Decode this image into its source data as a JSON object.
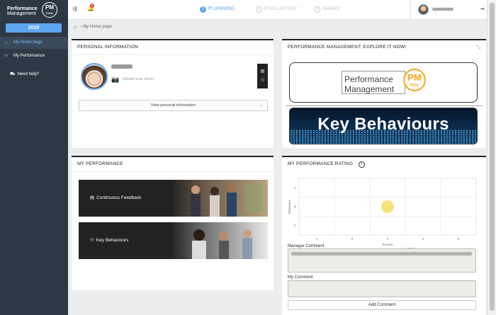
{
  "app": {
    "logo_line1": "Performance",
    "logo_line2": "Management",
    "logo_badge": "PM",
    "logo_badge_sub": "TOOL",
    "year": "2019"
  },
  "sidebar": {
    "items": [
      {
        "label": "My Home page",
        "icon": "home-icon",
        "active": true
      },
      {
        "label": "My Performance",
        "icon": "chevron-right-icon",
        "active": false
      }
    ],
    "help_label": "Need help?"
  },
  "header": {
    "steps": [
      {
        "num": "1",
        "label": "PLANNING",
        "active": true
      },
      {
        "num": "2",
        "label": "EVALUATION",
        "active": false
      },
      {
        "num": "3",
        "label": "SHARE",
        "active": false
      }
    ],
    "step_separator": "›",
    "notification_count": "9"
  },
  "breadcrumb": {
    "sep": "›",
    "label": "My Home page"
  },
  "personal": {
    "title": "PERSONAL INFORMATION",
    "upload_label": "Upload your photo",
    "view_button": "View personal information"
  },
  "explore": {
    "title": "PERFORMANCE MANAGEMENT: EXPLORE IT NOW!",
    "pm_line1": "Performance",
    "pm_line2": "Management",
    "pm_badge": "PM",
    "pm_badge_sub": "TOOL",
    "kb_label": "Key Behaviours"
  },
  "myperf": {
    "title": "MY PERFORMANCE",
    "cards": [
      {
        "label": "Continuous Feedback",
        "icon": "feedback-icon"
      },
      {
        "label": "Key Behaviours",
        "icon": "behaviours-icon"
      }
    ]
  },
  "rating": {
    "title": "MY PERFORMANCE RATING",
    "manager_comment_label": "Manager Comment",
    "my_comment_label": "My Comment",
    "add_button": "Add Comment"
  },
  "chart_data": {
    "type": "scatter",
    "title": "",
    "xlabel": "Results",
    "ylabel": "Behaviors",
    "x_ticks": [
      "1",
      "2",
      "3",
      "4",
      "5"
    ],
    "y_ticks": [
      "A",
      "B",
      "C"
    ],
    "series": [
      {
        "name": "2018",
        "color": "#f7e27a",
        "points": [
          {
            "x": 3,
            "y": "B"
          }
        ]
      }
    ],
    "legend": "bottom",
    "grid": true
  }
}
